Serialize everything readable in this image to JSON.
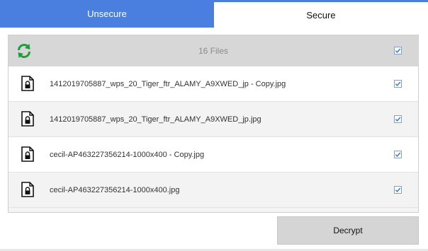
{
  "tabs": [
    {
      "label": "Unsecure",
      "active": false
    },
    {
      "label": "Secure",
      "active": true
    }
  ],
  "colors": {
    "accent": "#4a7fe0",
    "refresh": "#1e9e3a",
    "check": "#3a86c8"
  },
  "header": {
    "count_label": "16 Files",
    "refresh_icon": "refresh-icon",
    "select_all_checked": true
  },
  "files": [
    {
      "name": "1412019705887_wps_20_Tiger_ftr_ALAMY_A9XWED_jp - Copy.jpg",
      "icon": "locked-file-icon",
      "checked": true
    },
    {
      "name": "1412019705887_wps_20_Tiger_ftr_ALAMY_A9XWED_jp.jpg",
      "icon": "locked-file-icon",
      "checked": true
    },
    {
      "name": "cecil-AP463227356214-1000x400 - Copy.jpg",
      "icon": "locked-file-icon",
      "checked": true
    },
    {
      "name": "cecil-AP463227356214-1000x400.jpg",
      "icon": "locked-file-icon",
      "checked": true
    }
  ],
  "actions": {
    "decrypt_label": "Decrypt"
  }
}
